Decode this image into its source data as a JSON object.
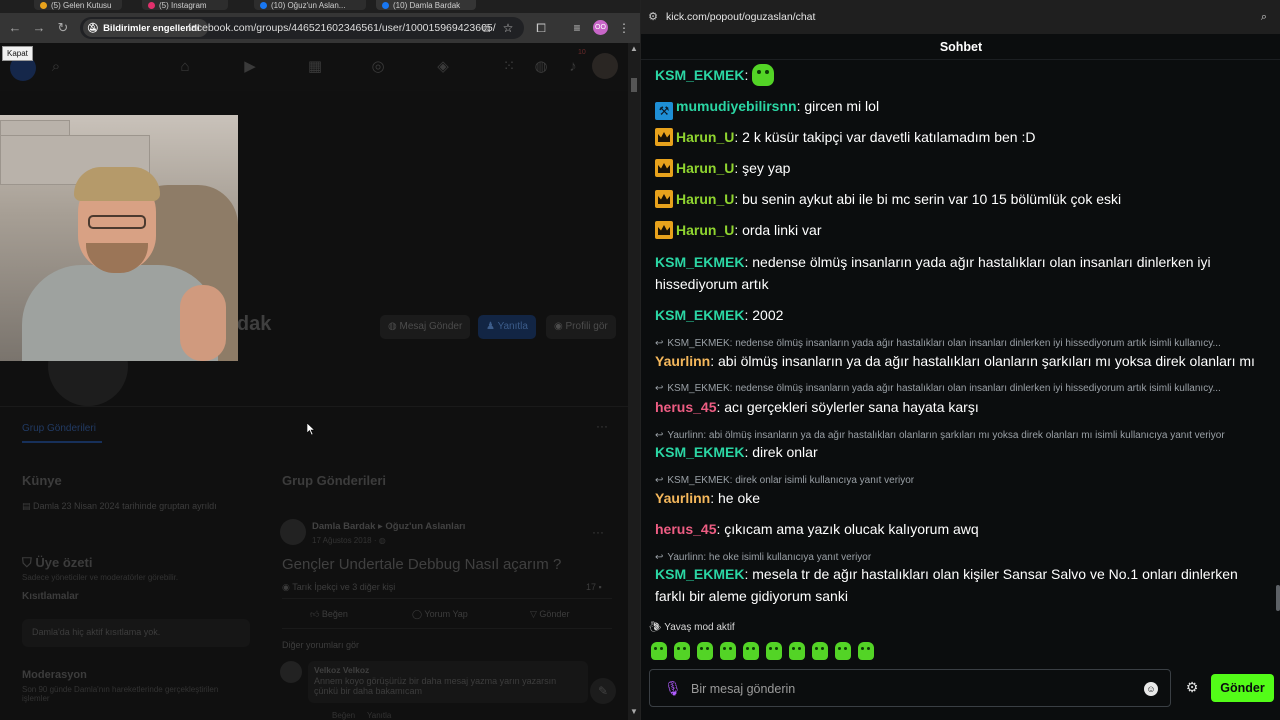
{
  "left_browser": {
    "tabs": [
      {
        "label": "(5) Gelen Kutusu",
        "color": "#e8a21c"
      },
      {
        "label": "(5) Instagram",
        "color": "#e1306c"
      },
      {
        "label": "(10) Oğuz'un Aslan...",
        "color": "#1877f2"
      },
      {
        "label": "(10) Damla Bardak",
        "color": "#1877f2"
      }
    ],
    "notification_chip": "Bildirimler engellendi",
    "url": "facebook.com/groups/446521602346561/user/100015969423605/",
    "close_tooltip": "Kapat",
    "profile_avatar_initials": "OO"
  },
  "facebook": {
    "notification_count": "10",
    "profile_name": "Damla Bardak",
    "buttons": {
      "message": "Mesaj Gönder",
      "reply": "Yanıtla",
      "view_profile": "Profili gör"
    },
    "tab": "Grup Gönderileri",
    "kunye": {
      "title": "Künye",
      "joined": "Damla 23 Nisan 2024 tarihinde gruptan ayrıldı"
    },
    "member_summary": {
      "title": "Üye özeti",
      "subtitle": "Sadece yöneticiler ve moderatörler görebilir.",
      "restrictions_title": "Kısıtlamalar",
      "restrictions_text": "Damla'da hiç aktif kısıtlama yok.",
      "moderation_title": "Moderasyon",
      "moderation_text": "Son 90 günde Damla'nın hareketlerinde gerçekleştirilen işlemler"
    },
    "posts": {
      "title": "Grup Gönderileri",
      "author": "Damla Bardak ▸ Oğuz'un Aslanları",
      "date": "17 Ağustos 2018 · ",
      "post_title": "Gençler Undertale Debbug Nasıl açarım ?",
      "reactions": "Tarık İpekçi ve 3 diğer kişi",
      "comment_count": "17",
      "actions": {
        "like": "Beğen",
        "comment": "Yorum Yap",
        "send": "Gönder"
      },
      "see_comments": "Diğer yorumları gör",
      "comment_author": "Velkoz Velkoz",
      "comment_text": "Annem koyo görüşürüz bir daha mesaj yazma yarın yazarsın çünkü bir daha bakamıcam",
      "comment_actions": [
        "Beğen",
        "Yanıtla"
      ]
    }
  },
  "kick": {
    "url": "kick.com/popout/oguzaslan/chat",
    "title": "Sohbet",
    "messages": [
      {
        "kind": "msg",
        "badge": "",
        "user": "KSM_EKMEK",
        "color": "#2bd6a4",
        "text": "",
        "emote": true
      },
      {
        "kind": "msg",
        "badge": "hammer",
        "user": "mumudiyebilirsnn",
        "color": "#2bd6a4",
        "text": "gircen mi lol"
      },
      {
        "kind": "msg",
        "badge": "crown",
        "user": "Harun_U",
        "color": "#90d530",
        "text": "2 k küsür takipçi var davetli katılamadım ben :D"
      },
      {
        "kind": "msg",
        "badge": "crown",
        "user": "Harun_U",
        "color": "#90d530",
        "text": "şey yap"
      },
      {
        "kind": "msg",
        "badge": "crown",
        "user": "Harun_U",
        "color": "#90d530",
        "text": "bu senin aykut abi ile bi mc serin var 10 15 bölümlük çok eski"
      },
      {
        "kind": "msg",
        "badge": "crown",
        "user": "Harun_U",
        "color": "#90d530",
        "text": "orda linki var"
      },
      {
        "kind": "msg",
        "badge": "",
        "user": "KSM_EKMEK",
        "color": "#2bd6a4",
        "text": "nedense ölmüş insanların yada ağır hastalıkları olan insanları dinlerken iyi hissediyorum artık"
      },
      {
        "kind": "msg",
        "badge": "",
        "user": "KSM_EKMEK",
        "color": "#2bd6a4",
        "text": "2002"
      },
      {
        "kind": "reply",
        "text": "KSM_EKMEK: nedense ölmüş insanların yada ağır hastalıkları olan insanları dinlerken iyi hissediyorum artık isimli kullanıcy..."
      },
      {
        "kind": "msg",
        "badge": "",
        "user": "Yaurlinn",
        "color": "#f5b85c",
        "text": "abi ölmüş insanların ya da ağır hastalıkları olanların şarkıları mı yoksa direk olanları mı"
      },
      {
        "kind": "reply",
        "text": "KSM_EKMEK: nedense ölmüş insanların yada ağır hastalıkları olan insanları dinlerken iyi hissediyorum artık isimli kullanıcy..."
      },
      {
        "kind": "msg",
        "badge": "",
        "user": "herus_45",
        "color": "#ee5d83",
        "text": "acı gerçekleri söylerler sana hayata karşı"
      },
      {
        "kind": "reply",
        "text": "Yaurlinn: abi ölmüş insanların ya da ağır hastalıkları olanların şarkıları mı yoksa direk olanları mı isimli kullanıcıya yanıt veriyor"
      },
      {
        "kind": "msg",
        "badge": "",
        "user": "KSM_EKMEK",
        "color": "#2bd6a4",
        "text": "direk onlar"
      },
      {
        "kind": "reply",
        "text": "KSM_EKMEK: direk onlar isimli kullanıcıya yanıt veriyor"
      },
      {
        "kind": "msg",
        "badge": "",
        "user": "Yaurlinn",
        "color": "#f5b85c",
        "text": "he oke"
      },
      {
        "kind": "msg",
        "badge": "",
        "user": "herus_45",
        "color": "#ee5d83",
        "text": "çıkıcam ama yazık olucak kalıyorum awq"
      },
      {
        "kind": "reply",
        "text": "Yaurlinn: he oke isimli kullanıcıya yanıt veriyor"
      },
      {
        "kind": "msg",
        "badge": "",
        "user": "KSM_EKMEK",
        "color": "#2bd6a4",
        "text": "mesela tr de ağır hastalıkları olan kişiler Sansar Salvo ve No.1 onları dinlerken farklı bir aleme gidiyorum sanki"
      }
    ],
    "slow_mode": "Yavaş mod aktif",
    "input_placeholder": "Bir mesaj gönderin",
    "send_label": "Gönder",
    "accent": "#53fc18"
  }
}
